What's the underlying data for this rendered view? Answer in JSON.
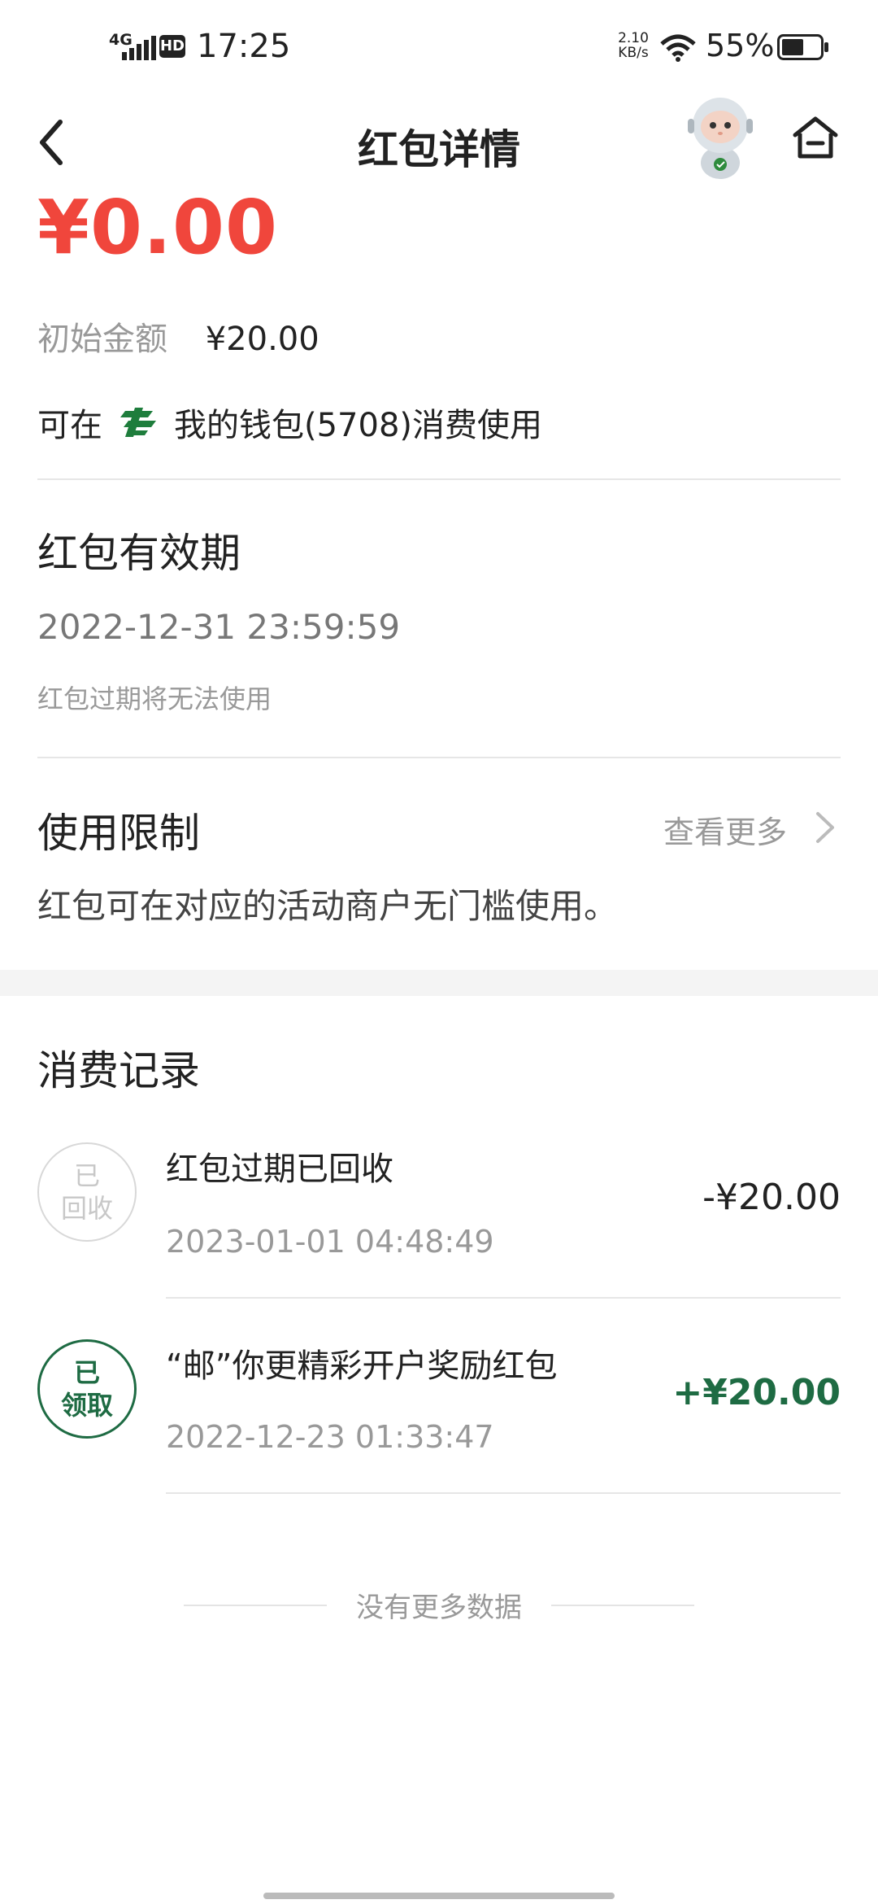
{
  "status_bar": {
    "network": "4G",
    "hd": "HD",
    "time": "17:25",
    "speed_value": "2.10",
    "speed_unit": "KB/s",
    "battery": "55%"
  },
  "nav": {
    "title": "红包详情",
    "icons": [
      "back-icon",
      "robot-assistant-icon",
      "home-icon"
    ]
  },
  "summary": {
    "balance": "¥0.00",
    "initial_label": "初始金额",
    "initial_value": "¥20.00",
    "usable_prefix": "可在",
    "usable_wallet": "我的钱包(5708)消费使用",
    "accent_color": "#f0463c",
    "brand_color": "#1e6b43"
  },
  "validity": {
    "title": "红包有效期",
    "date": "2022-12-31 23:59:59",
    "note": "红包过期将无法使用"
  },
  "limit": {
    "title": "使用限制",
    "see_more": "查看更多",
    "description": "红包可在对应的活动商户无门槛使用。"
  },
  "records": {
    "title": "消费记录",
    "items": [
      {
        "badge_line1": "已",
        "badge_line2": "回收",
        "title": "红包过期已回收",
        "time": "2023-01-01 04:48:49",
        "amount": "-¥20.00"
      },
      {
        "badge_line1": "已",
        "badge_line2": "领取",
        "title": "“邮”你更精彩开户奖励红包",
        "time": "2022-12-23 01:33:47",
        "amount": "+¥20.00"
      }
    ],
    "no_more": "没有更多数据"
  }
}
